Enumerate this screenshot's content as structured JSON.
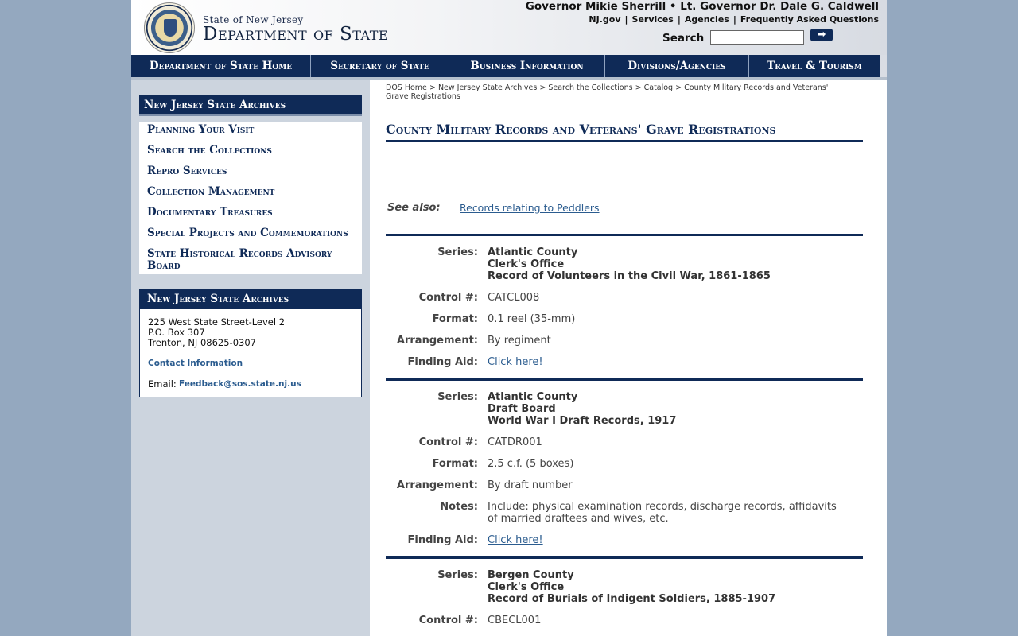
{
  "header": {
    "state_of": "State of New Jersey",
    "department": "Department of State",
    "governor_line": "Governor Mikie Sherrill • Lt. Governor Dr. Dale G. Caldwell",
    "top_links": [
      "NJ.gov",
      "Services",
      "Agencies",
      "Frequently Asked Questions"
    ],
    "search_label": "Search",
    "search_button_icon": "arrow-right-icon"
  },
  "nav": {
    "items": [
      "Department of State Home",
      "Secretary of State",
      "Business Information",
      "Divisions/Agencies",
      "Travel & Tourism"
    ]
  },
  "sidebar": {
    "menu_title": "New Jersey State Archives",
    "menu_items": [
      "Planning Your Visit",
      "Search the Collections",
      "Repro Services",
      "Collection Management",
      "Documentary Treasures",
      "Special Projects and Commemorations",
      "State Historical Records Advisory Board"
    ],
    "info_title": "New Jersey State Archives",
    "address": [
      "225 West State Street-Level 2",
      "P.O. Box 307",
      "Trenton, NJ 08625-0307"
    ],
    "contact_label": "Contact Information",
    "email_label": "Email:",
    "email": "Feedback@sos.state.nj.us"
  },
  "breadcrumb": {
    "links": [
      "DOS Home",
      "New Jersey State Archives",
      "Search the Collections",
      "Catalog"
    ],
    "current": "County Military Records and Veterans' Grave Registrations",
    "separator": ">"
  },
  "main": {
    "title": "County Military Records and Veterans' Grave Registrations",
    "see_also_label": "See also:",
    "see_also_link": "Records relating to Peddlers"
  },
  "records": [
    {
      "series_label": "Series:",
      "series": [
        "Atlantic County",
        "Clerk's Office",
        "Record of Volunteers in the Civil War, 1861-1865"
      ],
      "control_label": "Control #:",
      "control": "CATCL008",
      "format_label": "Format:",
      "format": "0.1 reel (35-mm)",
      "arrangement_label": "Arrangement:",
      "arrangement": "By regiment",
      "finding_label": "Finding Aid:",
      "finding": "Click here!"
    },
    {
      "series_label": "Series:",
      "series": [
        "Atlantic County",
        "Draft Board",
        "World War I Draft Records, 1917"
      ],
      "control_label": "Control #:",
      "control": "CATDR001",
      "format_label": "Format:",
      "format": "2.5 c.f. (5 boxes)",
      "arrangement_label": "Arrangement:",
      "arrangement": "By draft number",
      "notes_label": "Notes:",
      "notes": "Include: physical examination records, discharge records, affidavits of married draftees and wives, etc.",
      "finding_label": "Finding Aid:",
      "finding": "Click here!"
    },
    {
      "series_label": "Series:",
      "series": [
        "Bergen County",
        "Clerk's Office",
        "Record of Burials of Indigent Soldiers, 1885-1907"
      ],
      "control_label": "Control #:",
      "control": "CBECL001"
    }
  ],
  "colors": {
    "navy": "#0f2a57",
    "link": "#2b5c8f",
    "page_bg": "#94a8bf",
    "sidebar_bg": "#ccd4de"
  }
}
